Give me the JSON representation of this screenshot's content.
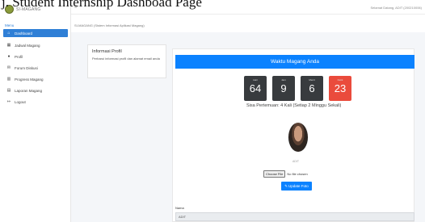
{
  "figure_caption": "j. Student Internship Dashboad Page",
  "sidebar": {
    "brand": "SI-MAGANG",
    "menu_header": "Menu",
    "items": [
      {
        "label": "Dashboard",
        "icon": "home-icon",
        "glyph": "⌂",
        "active": true
      },
      {
        "label": "Jadwal Magang",
        "icon": "calendar-icon",
        "glyph": "▦",
        "active": false
      },
      {
        "label": "Profil",
        "icon": "user-icon",
        "glyph": "●",
        "active": false
      },
      {
        "label": "Forum Diskusi",
        "icon": "chat-icon",
        "glyph": "✉",
        "active": false
      },
      {
        "label": "Progress Magang",
        "icon": "chart-icon",
        "glyph": "▥",
        "active": false
      },
      {
        "label": "Laporan Magang",
        "icon": "document-icon",
        "glyph": "▤",
        "active": false
      },
      {
        "label": "Logout",
        "icon": "logout-icon",
        "glyph": "↦",
        "active": false
      }
    ]
  },
  "topbar": {
    "menu_icon": "hamburger-icon",
    "user_text": "Selamat Datang, ADIT (200210006)"
  },
  "breadcrumb": "SI-MAGANG (Sistem Informasi Aplikasi Magang)",
  "info_card": {
    "title": "Informasi Profil",
    "description": "Perbarui informasi profil dan alamat email anda"
  },
  "countdown": {
    "title": "Waktu Magang Anda",
    "boxes": [
      {
        "label": "Hari",
        "value": "64",
        "color": "#383b3e"
      },
      {
        "label": "Jam",
        "value": "9",
        "color": "#383b3e"
      },
      {
        "label": "Menit",
        "value": "6",
        "color": "#383b3e"
      },
      {
        "label": "Detik",
        "value": "23",
        "color": "#ea4b3c"
      }
    ],
    "meetings_text": "Sisa Pertemuan: 4 Kali (Setiap 2 Minggu Sekali)"
  },
  "profile": {
    "avatar_name": "ADIT",
    "file_button": "Choose File",
    "file_status": "No file chosen",
    "update_button": "Update Foto",
    "update_icon": "save-icon",
    "name_label": "Nama",
    "name_value": "ADIT"
  },
  "colors": {
    "accent": "#0b82ff",
    "sidebar_active": "#2f7fd6",
    "timer_dark": "#383b3e",
    "timer_red": "#ea4b3c"
  }
}
